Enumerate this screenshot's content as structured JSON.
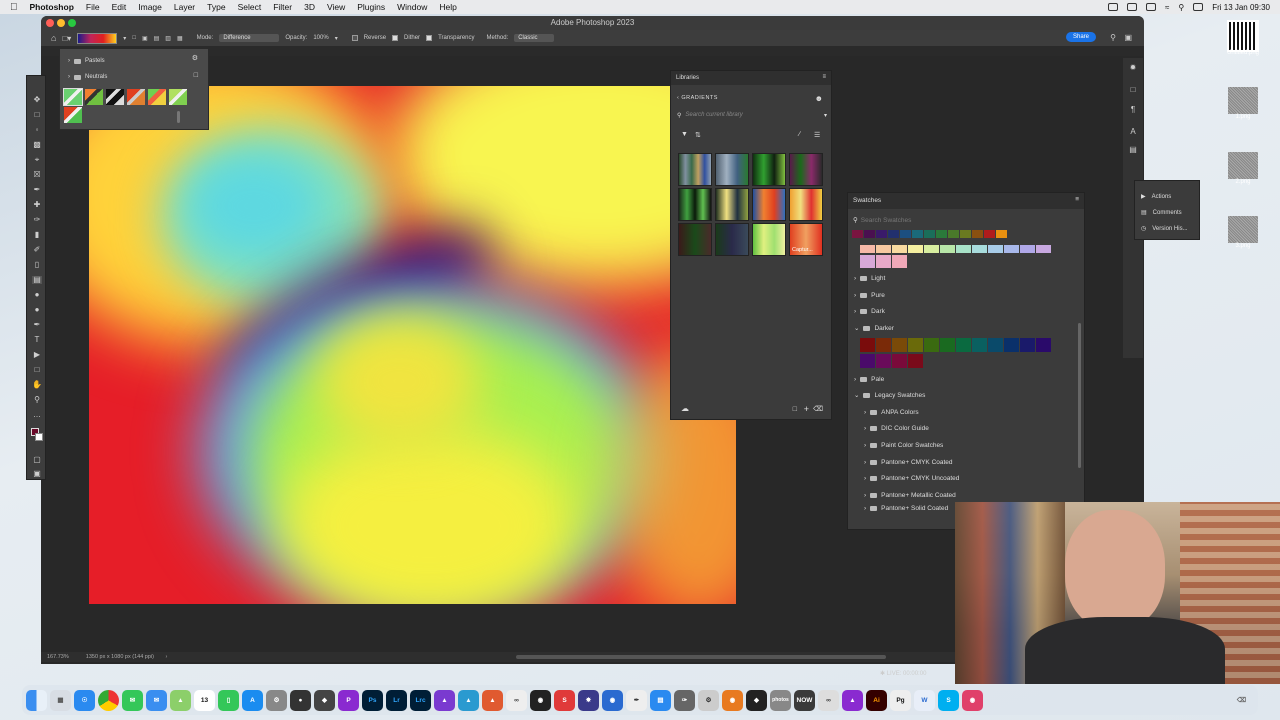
{
  "menubar": {
    "app_name": "Photoshop",
    "menus": [
      "File",
      "Edit",
      "Image",
      "Layer",
      "Type",
      "Select",
      "Filter",
      "3D",
      "View",
      "Plugins",
      "Window",
      "Help"
    ],
    "datetime": "Fri 13 Jan  09:30"
  },
  "window": {
    "title": "Adobe Photoshop 2023"
  },
  "options": {
    "mode_label": "Mode:",
    "mode_value": "Difference",
    "opacity_label": "Opacity:",
    "opacity_value": "100%",
    "reverse_label": "Reverse",
    "dither_label": "Dither",
    "transparency_label": "Transparency",
    "method_label": "Method:",
    "method_value": "Classic",
    "share_label": "Share"
  },
  "gradient_picker": {
    "folders": [
      "Pastels",
      "Neutrals"
    ]
  },
  "libraries": {
    "tab_label": "Libraries",
    "section_label": "GRADIENTS",
    "search_placeholder": "Search current library",
    "last_thumb_label": "Captur..."
  },
  "swatches": {
    "tab_label": "Swatches",
    "search_placeholder": "Search Swatches",
    "groups": [
      "Light",
      "Pure",
      "Dark",
      "Darker",
      "Pale",
      "Legacy Swatches"
    ],
    "legacy_subgroups": [
      "ANPA Colors",
      "DIC Color Guide",
      "Paint Color Swatches",
      "Pantone+ CMYK Coated",
      "Pantone+ CMYK Uncoated",
      "Pantone+ Metallic Coated",
      "Pantone+ Solid Coated"
    ],
    "top_row": [
      "#7a1440",
      "#4a1050",
      "#3a1a6a",
      "#22306e",
      "#1c4f80",
      "#1a6a7a",
      "#1a6e5a",
      "#2a7a3a",
      "#4a7a2a",
      "#6a7a20",
      "#8a5010",
      "#b01c1c",
      "#e89010"
    ],
    "pastel_row": [
      "#f7b9a8",
      "#f7c8a0",
      "#f8daa0",
      "#f5efa0",
      "#d8eea0",
      "#b8e6a8",
      "#a8e2c8",
      "#a8dcdc",
      "#a8cce8",
      "#a8b8ea",
      "#b0a8e8",
      "#c8a8e0"
    ],
    "pastel_row2": [
      "#d8a8d8",
      "#e8a8c8",
      "#f0a8b8"
    ],
    "darker_row1": [
      "#7a0c0c",
      "#7a2a08",
      "#7a4a08",
      "#6a6a0a",
      "#3a6a10",
      "#1a6a20",
      "#0a6a40",
      "#0a6060",
      "#0a4a6a",
      "#0a306a",
      "#1a1a6a",
      "#2a0a6a"
    ],
    "darker_row2": [
      "#4a0a6a",
      "#6a0a5a",
      "#7a0a3a",
      "#7a0a1a"
    ]
  },
  "actions_panel": {
    "items": [
      "Actions",
      "Comments",
      "Version His..."
    ]
  },
  "status": {
    "zoom": "167.73%",
    "doc_info": "1350 px x 1080 px (144 ppi)",
    "live": "LIVE: 00:00:00"
  },
  "desktop_icons": [
    "Untitled.png",
    "1.png",
    "2.png",
    "3.png"
  ],
  "dock": {
    "items": [
      "Finder",
      "Launchpad",
      "Safari",
      "Chrome",
      "Messages",
      "Mail",
      "Maps",
      "Calendar",
      "Numbers",
      "App Store",
      "Settings",
      "Camera",
      "DaVinci",
      "Ps",
      "Lr",
      "Lrc",
      "Affinity",
      "Affinity",
      "Affinity",
      "Coda",
      "Shazam",
      "Motion",
      "Preview",
      "Pages",
      "Files",
      "Brush",
      "Screens",
      "Blender",
      "Notion",
      "Photos",
      "NOW",
      "Link",
      "Affinity",
      "Ai",
      "Pg",
      "W",
      "Skype",
      "Screen",
      "Trash"
    ],
    "calendar_day": "13",
    "pinned_labels": [
      "Ps",
      "Lr",
      "Lrc",
      "NOW",
      "Ai",
      "Pg",
      "W"
    ]
  },
  "colors": {
    "accent": "#1a73e8",
    "panel_bg": "#3b3b3b",
    "app_bg": "#282828"
  }
}
